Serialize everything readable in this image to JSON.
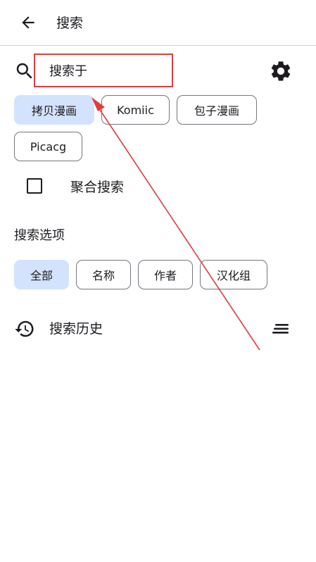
{
  "appbar": {
    "title": "搜索",
    "back_icon": "arrow-back-icon"
  },
  "search": {
    "value": "搜索于",
    "icon": "search-icon",
    "settings_icon": "gear-icon"
  },
  "sources": [
    {
      "label": "拷贝漫画",
      "selected": true
    },
    {
      "label": "Komiic",
      "selected": false
    },
    {
      "label": "包子漫画",
      "selected": false
    },
    {
      "label": "Picacg",
      "selected": false
    }
  ],
  "aggregate": {
    "label": "聚合搜索",
    "checked": false
  },
  "options": {
    "title": "搜索选项",
    "chips": [
      {
        "label": "全部",
        "selected": true
      },
      {
        "label": "名称",
        "selected": false
      },
      {
        "label": "作者",
        "selected": false
      },
      {
        "label": "汉化组",
        "selected": false
      }
    ]
  },
  "history": {
    "label": "搜索历史",
    "icon": "history-icon",
    "sort_icon": "sort-icon"
  },
  "colors": {
    "accent_chip": "#d3e3fd",
    "annotation": "#e23c3c",
    "outline": "#79747e"
  }
}
